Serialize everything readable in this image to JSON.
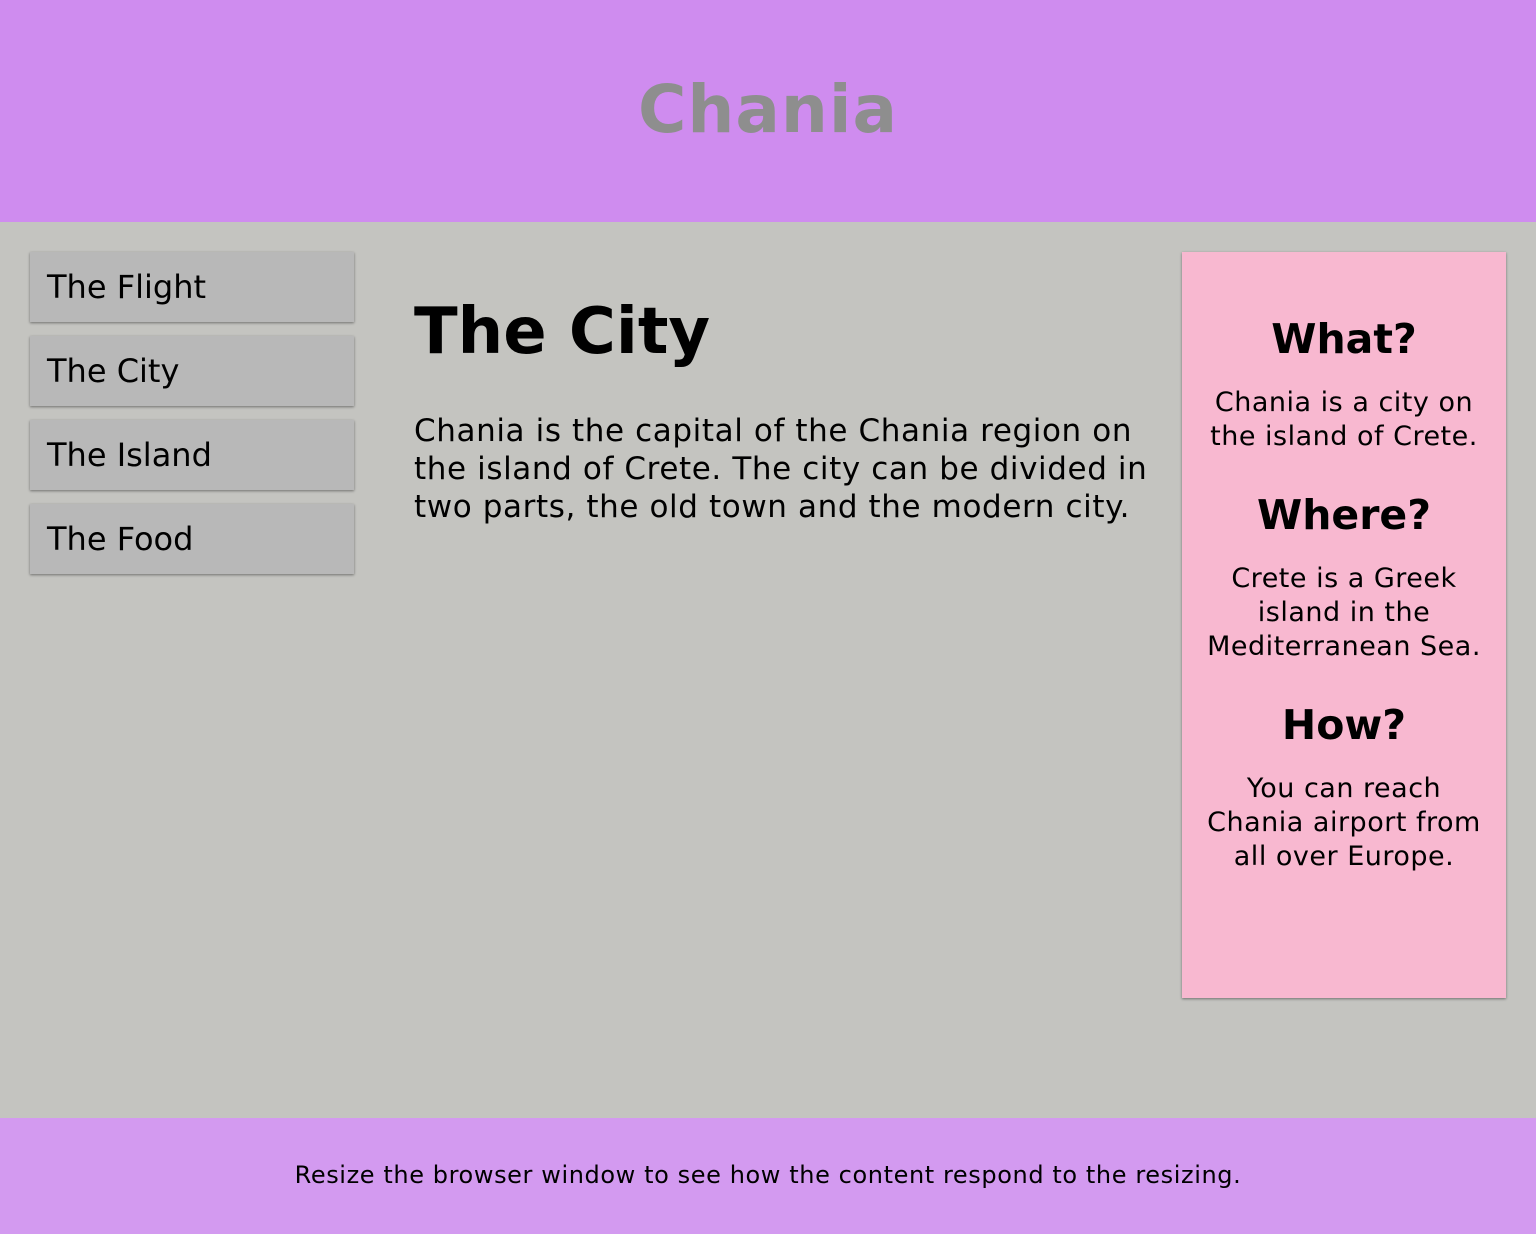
{
  "header": {
    "title": "Chania"
  },
  "menu": {
    "items": [
      {
        "label": "The Flight"
      },
      {
        "label": "The City"
      },
      {
        "label": "The Island"
      },
      {
        "label": "The Food"
      }
    ]
  },
  "main": {
    "heading": "The City",
    "paragraph": "Chania is the capital of the Chania region on the island of Crete. The city can be divided in two parts, the old town and the modern city."
  },
  "aside": {
    "sections": [
      {
        "heading": "What?",
        "text": "Chania is a city on the island of Crete."
      },
      {
        "heading": "Where?",
        "text": "Crete is a Greek island in the Mediterranean Sea."
      },
      {
        "heading": "How?",
        "text": "You can reach Chania airport from all over Europe."
      }
    ]
  },
  "footer": {
    "text": "Resize the browser window to see how the content respond to the resizing."
  },
  "colors": {
    "header_bg": "#cf8cef",
    "footer_bg": "#d39af0",
    "page_bg": "#c4c4c0",
    "menu_item_bg": "#b8b8b8",
    "aside_bg": "#f8b8d0",
    "title_text": "#8e8e8e"
  }
}
